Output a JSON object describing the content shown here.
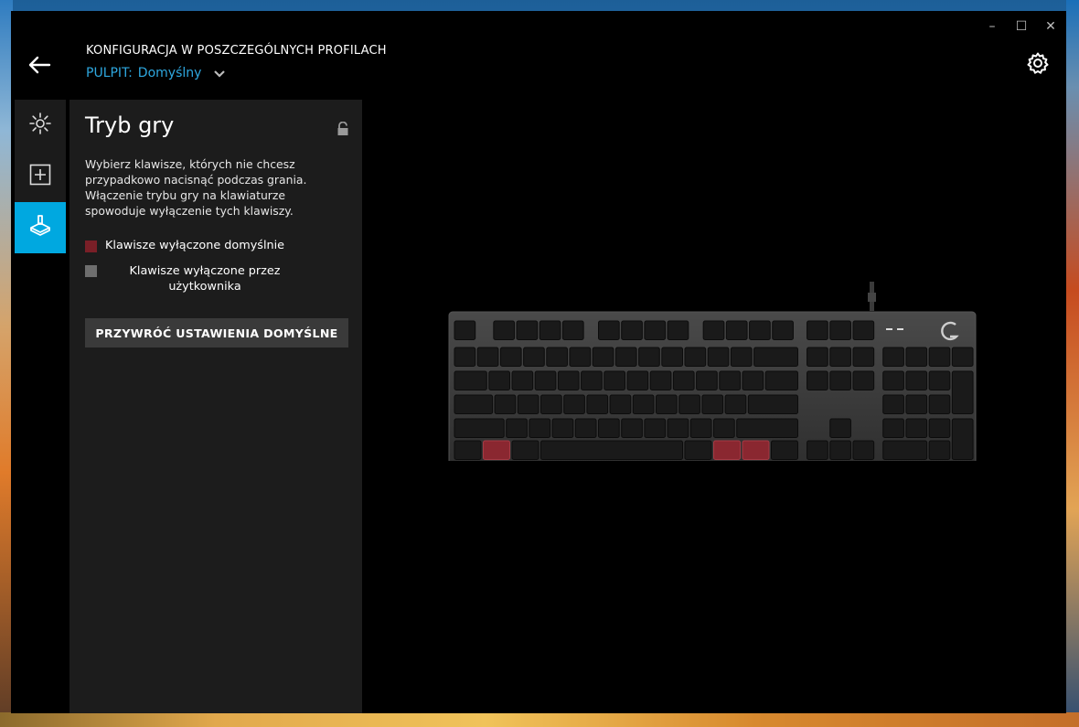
{
  "header": {
    "title": "KONFIGURACJA W POSZCZEGÓLNYCH PROFILACH",
    "profile_label": "PULPIT:",
    "profile_value": "Domyślny"
  },
  "window_controls": {
    "minimize": "–",
    "maximize": "☐",
    "close": "✕"
  },
  "sidebar": {
    "items": [
      {
        "icon": "lighting-icon",
        "active": false
      },
      {
        "icon": "assignments-icon",
        "active": false
      },
      {
        "icon": "game-mode-icon",
        "active": true
      }
    ]
  },
  "panel": {
    "title": "Tryb gry",
    "description": "Wybierz klawisze, których nie chcesz przypadkowo nacisnąć podczas grania. Włączenie trybu gry na klawiaturze spowoduje wyłączenie tych klawiszy.",
    "legend": [
      {
        "label": "Klawisze wyłączone domyślnie",
        "color": "#7a1f27"
      },
      {
        "label": "Klawisze wyłączone przez użytkownika",
        "color": "#6e6e6e"
      }
    ],
    "reset_button": "PRZYWRÓĆ USTAWIENIA DOMYŚLNE"
  },
  "colors": {
    "accent": "#00a8e0",
    "profile_text": "#2ea8e0",
    "panel_bg": "#1c1c1c",
    "disabled_default": "#7a1f27",
    "disabled_user": "#6e6e6e"
  }
}
